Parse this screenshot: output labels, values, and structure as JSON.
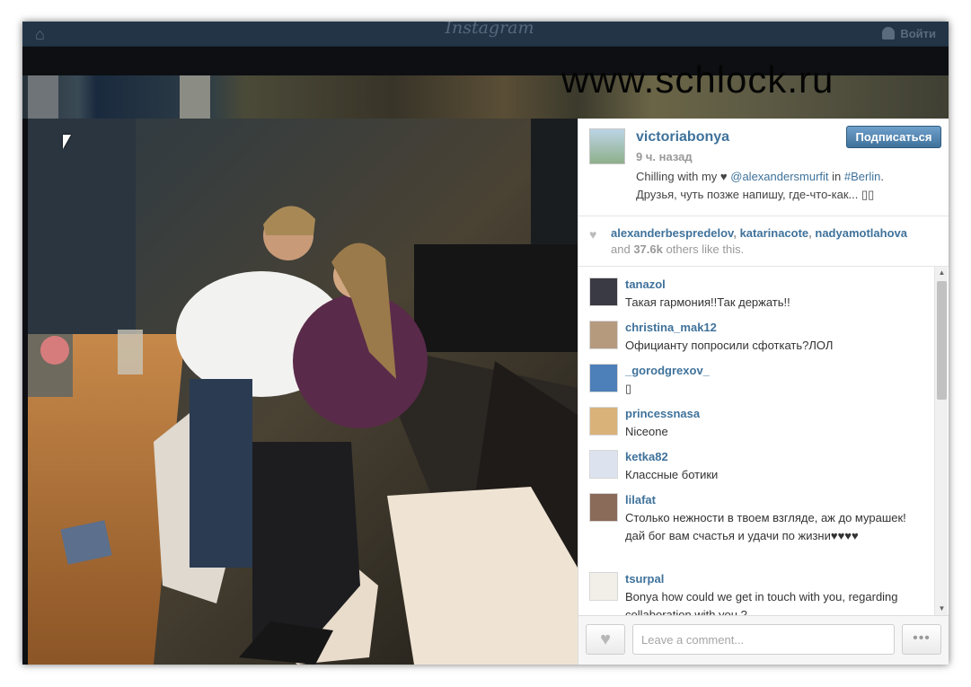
{
  "nav": {
    "logo": "Instagram",
    "login_label": "Войти"
  },
  "watermark": "www.schlock.ru",
  "post": {
    "username": "victoriabonya",
    "time": "9 ч. назад",
    "follow_label": "Подписаться",
    "caption_pre": "Chilling with my ♥ ",
    "caption_mention": "@alexandersmurfit",
    "caption_mid": " in ",
    "caption_tag": "#Berlin",
    "caption_post": ".",
    "caption_line2": "Друзья, чуть позже напишу, где-что-как... ",
    "caption_emoji": "▯▯"
  },
  "likes": {
    "users": [
      "alexanderbespredelov",
      "katarinacote",
      "nadyamotlahova"
    ],
    "and_label": "and",
    "count": "37.6k",
    "suffix": "others like this."
  },
  "comments": [
    {
      "user": "tanazol",
      "text": "Такая гармония!!Так держать!!",
      "avatar_color": "#3a3a44"
    },
    {
      "user": "christina_mak12",
      "text": "Официанту попросили сфоткать?ЛОЛ",
      "avatar_color": "#b59a7e"
    },
    {
      "user": "_gorodgrexov_",
      "text": "▯",
      "avatar_color": "#4d7fb8"
    },
    {
      "user": "princessnasa",
      "text": "Niceone",
      "avatar_color": "#d9b27a"
    },
    {
      "user": "ketka82",
      "text": "Классные ботики",
      "avatar_color": "#dde3ee"
    },
    {
      "user": "lilafat",
      "text": "Столько нежности в твоем взгляде, аж до мурашек! дай бог вам счастья и удачи по жизни♥♥♥♥",
      "avatar_color": "#8a6a58"
    },
    {
      "user": "tsurpal",
      "text": "Bonya how could we get in touch with you, regarding collaboration with you ?",
      "avatar_color": "#f2efe9"
    }
  ],
  "footer": {
    "comment_placeholder": "Leave a comment...",
    "more_label": "•••"
  },
  "colors": {
    "link": "#3f729b",
    "nav": "#233447"
  }
}
